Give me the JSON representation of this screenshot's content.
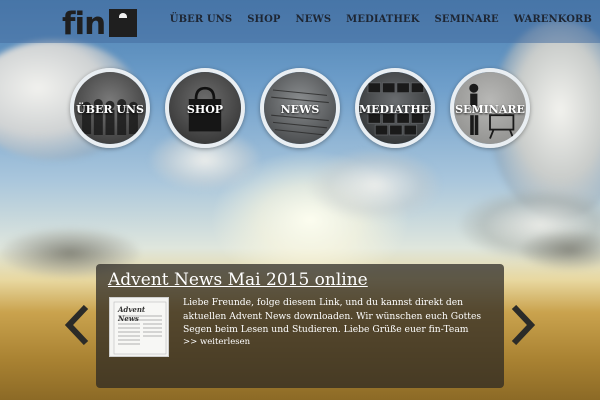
{
  "brand": {
    "logo_text": "fin"
  },
  "nav": {
    "items": [
      {
        "label": "ÜBER UNS"
      },
      {
        "label": "SHOP"
      },
      {
        "label": "NEWS"
      },
      {
        "label": "MEDIATHEK"
      },
      {
        "label": "SEMINARE"
      },
      {
        "label": "WARENKORB"
      }
    ]
  },
  "tiles": [
    {
      "label": "ÜBER UNS",
      "icon": "people-icon"
    },
    {
      "label": "SHOP",
      "icon": "shopping-bag-icon"
    },
    {
      "label": "NEWS",
      "icon": "newspaper-icon"
    },
    {
      "label": "MEDIATHEK",
      "icon": "media-grid-icon"
    },
    {
      "label": "SEMINARE",
      "icon": "presenter-icon"
    }
  ],
  "news": {
    "title": "Advent News Mai 2015 online",
    "body": "Liebe Freunde, folge diesem Link, und du kannst direkt den aktuellen Advent News downloaden. Wir wünschen euch Gottes Segen beim Lesen und Studieren. Liebe Grüße euer fin-Team",
    "read_more": ">> weiterlesen",
    "thumb_caption": "Advent News"
  },
  "colors": {
    "header_bg": "#466ea0",
    "panel_bg": "#28261f",
    "ring": "#e9eef2"
  }
}
